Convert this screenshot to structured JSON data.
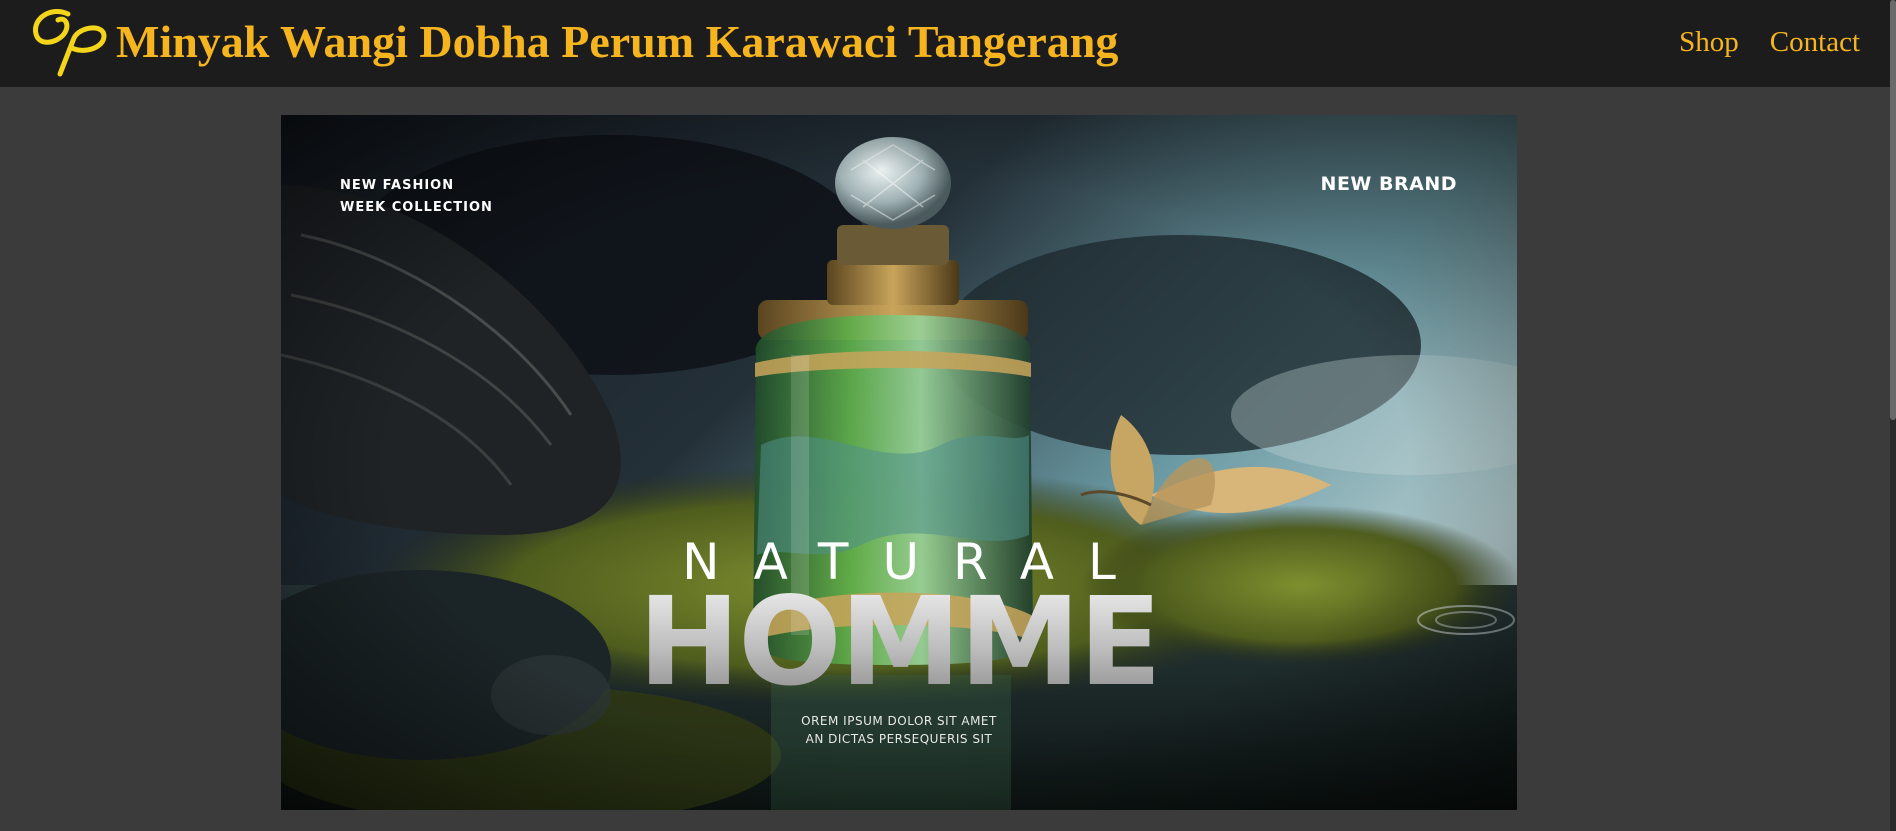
{
  "header": {
    "title": "Minyak Wangi Dobha Perum Karawaci Tangerang",
    "nav": {
      "shop": "Shop",
      "contact": "Contact"
    }
  },
  "hero": {
    "tag_left_line1": "NEW FASHION",
    "tag_left_line2": "WEEK COLLECTION",
    "tag_right": "NEW BRAND",
    "headline_top": "NATURAL",
    "headline_main": "HOMME",
    "subline1": "OREM IPSUM DOLOR SIT AMET",
    "subline2": "AN DICTAS PERSEQUERIS SIT"
  },
  "colors": {
    "header_bg": "#1c1c1c",
    "accent": "#f6b51f",
    "page_bg": "#3b3b3b"
  }
}
